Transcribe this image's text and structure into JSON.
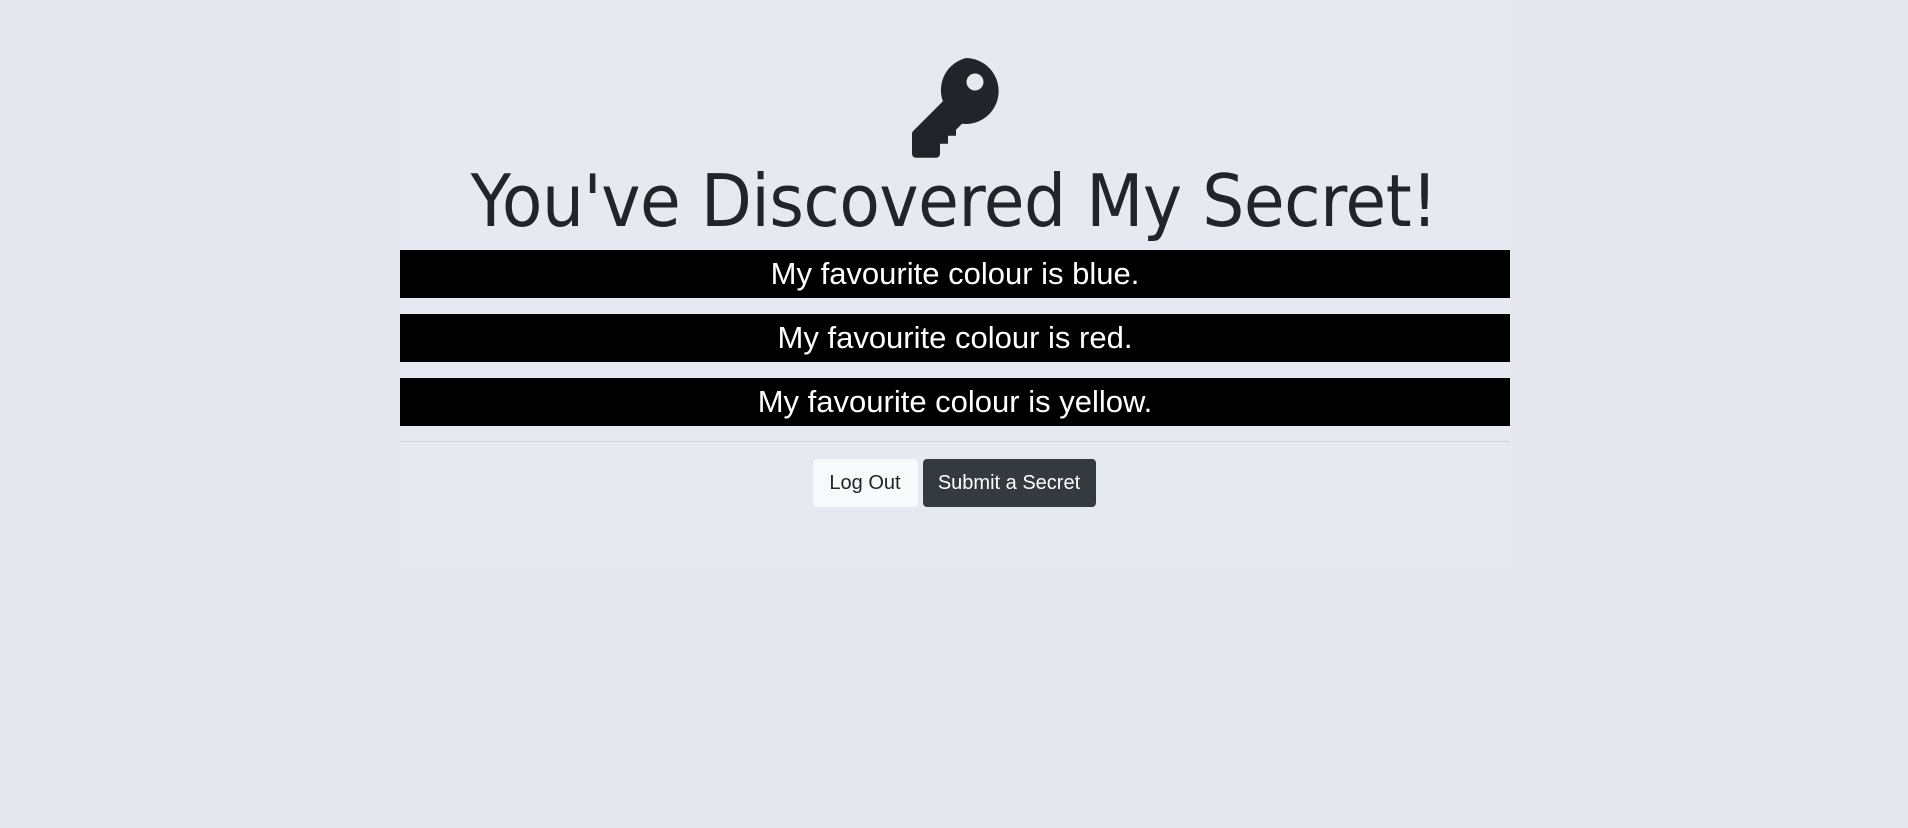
{
  "icon": "key-icon",
  "title": "You've Discovered My Secret!",
  "secrets": [
    "My favourite colour is blue.",
    "My favourite colour is red.",
    "My favourite colour is yellow."
  ],
  "buttons": {
    "logout_label": "Log Out",
    "submit_label": "Submit a Secret"
  },
  "colors": {
    "background": "#e5e9ef",
    "secret_bg": "#000000",
    "secret_text": "#ffffff",
    "dark_button": "#343a40",
    "light_button": "#f8f9fa",
    "text": "#212529"
  }
}
